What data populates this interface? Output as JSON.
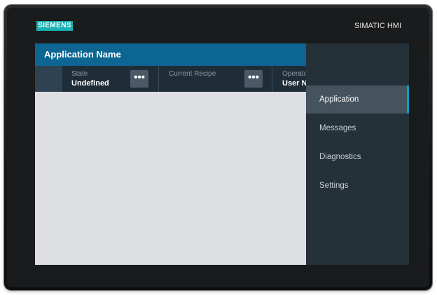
{
  "device": {
    "brand": "SIEMENS",
    "model": "SIMATIC HMI"
  },
  "header": {
    "title": "Application Name"
  },
  "status": [
    {
      "label": "State",
      "value": "Undefined",
      "more": "•••"
    },
    {
      "label": "Current Recipe",
      "value": "",
      "more": "•••"
    },
    {
      "label": "Operator",
      "value": "User Name"
    }
  ],
  "nav": {
    "items": [
      {
        "label": "Application",
        "active": true
      },
      {
        "label": "Messages"
      },
      {
        "label": "Diagnostics"
      },
      {
        "label": "Settings"
      }
    ]
  },
  "colors": {
    "title_bar": "#0d6592",
    "status_bar": "#1f2d38",
    "nav_panel": "#253139",
    "nav_active": "#44535e",
    "active_marker": "#00a6c4",
    "brand": "#19b0b1",
    "content": "#dddfe2"
  }
}
